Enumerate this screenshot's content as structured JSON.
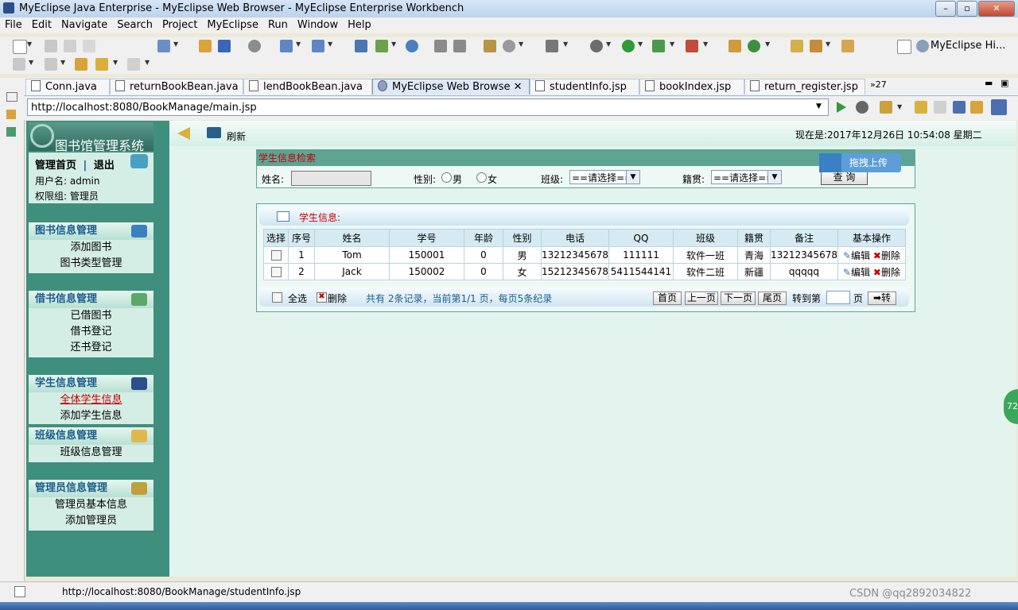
{
  "window": {
    "title": "MyEclipse Java Enterprise - MyEclipse Web Browser - MyEclipse Enterprise Workbench"
  },
  "menu": [
    "File",
    "Edit",
    "Navigate",
    "Search",
    "Project",
    "MyEclipse",
    "Run",
    "Window",
    "Help"
  ],
  "perspective": "MyEclipse Hi...",
  "tabs": [
    {
      "label": "Conn.java",
      "active": false
    },
    {
      "label": "returnBookBean.java",
      "active": false
    },
    {
      "label": "lendBookBean.java",
      "active": false
    },
    {
      "label": "MyEclipse Web Browse",
      "active": true
    },
    {
      "label": "studentInfo.jsp",
      "active": false
    },
    {
      "label": "bookIndex.jsp",
      "active": false
    },
    {
      "label": "return_register.jsp",
      "active": false
    }
  ],
  "tab_overflow": "»27",
  "url": "http://localhost:8080/BookManage/main.jsp",
  "page": {
    "logo_text": "图书馆管理系统",
    "refresh_label": "刷新",
    "now_text": "现在是:2017年12月26日  10:54:08  星期二",
    "upload_label": "拖拽上传",
    "nav": {
      "home": "管理首页",
      "sep": "|",
      "logout": "退出",
      "username": "用户名: admin",
      "role": "权限组: 管理员",
      "sections": [
        {
          "title": "图书信息管理",
          "items": [
            "添加图书",
            "图书类型管理"
          ]
        },
        {
          "title": "借书信息管理",
          "items": [
            "已借图书",
            "借书登记",
            "还书登记"
          ]
        },
        {
          "title": "学生信息管理",
          "items": [
            "全体学生信息",
            "添加学生信息"
          ]
        },
        {
          "title": "班级信息管理",
          "items": [
            "班级信息管理"
          ]
        },
        {
          "title": "管理员信息管理",
          "items": [
            "管理员基本信息",
            "添加管理员"
          ]
        }
      ]
    },
    "search": {
      "title": "学生信息检索",
      "name_label": "姓名:",
      "gender_label": "性别:",
      "male": "男",
      "female": "女",
      "class_label": "班级:",
      "class_value": "==请选择==",
      "origin_label": "籍贯:",
      "origin_value": "==请选择==",
      "query_button": "查 询"
    },
    "results": {
      "title": "学生信息:",
      "columns": [
        "选择",
        "序号",
        "姓名",
        "学号",
        "年龄",
        "性别",
        "电话",
        "QQ",
        "班级",
        "籍贯",
        "备注",
        "基本操作"
      ],
      "rows": [
        [
          "",
          "1",
          "Tom",
          "150001",
          "0",
          "男",
          "13212345678",
          "111111",
          "软件一班",
          "青海",
          "13212345678"
        ],
        [
          "",
          "2",
          "Jack",
          "150002",
          "0",
          "女",
          "15212345678",
          "5411544141",
          "软件二班",
          "新疆",
          "qqqqq"
        ]
      ],
      "edit_label": "编辑",
      "delete_label": "删除",
      "select_all": "全选",
      "bulk_delete": "删除",
      "summary": "共有 2条记录，当前第1/1 页，每页5条纪录",
      "first": "首页",
      "prev": "上一页",
      "next": "下一页",
      "last": "尾页",
      "goto_label": "转到第",
      "page_unit": "页",
      "go_button": "➡转"
    }
  },
  "status_url": "http://localhost:8080/BookManage/studentInfo.jsp",
  "watermark": "CSDN @qq2892034822",
  "badge": "72"
}
